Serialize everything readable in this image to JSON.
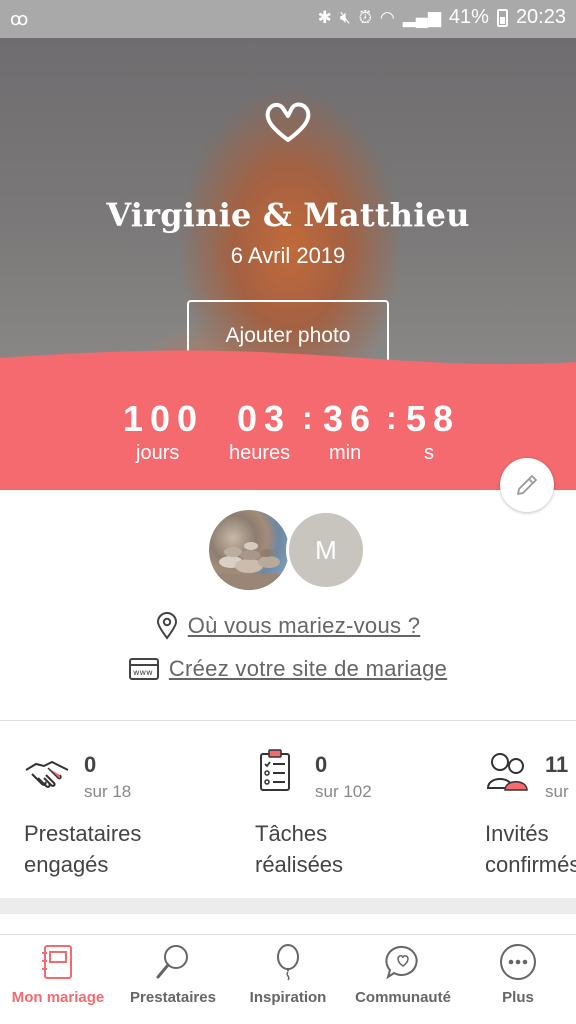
{
  "statusbar": {
    "battery": "41%",
    "time": "20:23"
  },
  "hero": {
    "couple": "Virginie & Matthieu",
    "date": "6 Avril 2019",
    "add_photo": "Ajouter photo"
  },
  "countdown": {
    "days": "100",
    "hours": "03",
    "minutes": "36",
    "seconds": "58",
    "sep": ":",
    "days_label": "jours",
    "hours_label": "heures",
    "minutes_label": "min",
    "seconds_label": "s"
  },
  "profile": {
    "avatar_initial": "M",
    "venue_link": "Où vous mariez-vous ?",
    "site_link": "Créez votre site de mariage"
  },
  "stats": [
    {
      "value": "0",
      "total": "sur 18",
      "label_line1": "Prestataires",
      "label_line2": "engagés"
    },
    {
      "value": "0",
      "total": "sur 102",
      "label_line1": "Tâches",
      "label_line2": "réalisées"
    },
    {
      "value": "11",
      "total": "sur",
      "label_line1": "Invités",
      "label_line2": "confirmés"
    }
  ],
  "nav": [
    {
      "label": "Mon mariage",
      "active": true
    },
    {
      "label": "Prestataires"
    },
    {
      "label": "Inspiration"
    },
    {
      "label": "Communauté"
    },
    {
      "label": "Plus"
    }
  ],
  "colors": {
    "accent": "#f46a6e",
    "statusbar": "#a9a9a9"
  }
}
